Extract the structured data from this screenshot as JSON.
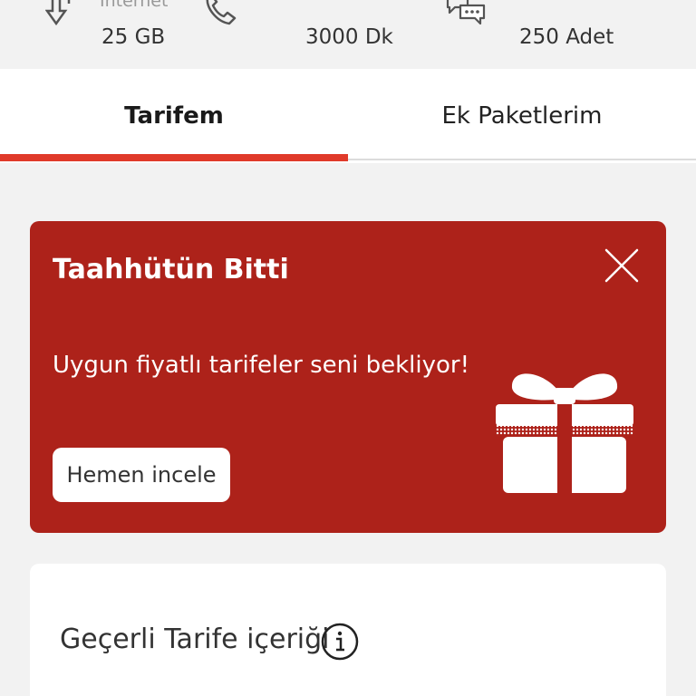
{
  "usage": {
    "items": [
      {
        "label": "İnternet",
        "value": "25 GB",
        "icon": "data-transfer-icon"
      },
      {
        "label": "",
        "value": "3000 Dk",
        "icon": "phone-icon"
      },
      {
        "label": "",
        "value": "250 Adet",
        "icon": "sms-chat-icon"
      }
    ]
  },
  "tabs": [
    {
      "label": "Tarifem",
      "active": true
    },
    {
      "label": "Ek Paketlerim",
      "active": false
    }
  ],
  "promo": {
    "title": "Taahhütün Bitti",
    "text": "Uygun fiyatlı tarifeler seni bekliyor!",
    "button": "Hemen incele",
    "bg_color": "#ad221a"
  },
  "info_card": {
    "title": "Geçerli Tarife içeriği"
  },
  "colors": {
    "accent": "#e03a2a",
    "promo_bg": "#ad221a",
    "page_bg": "#f2f2f2"
  }
}
